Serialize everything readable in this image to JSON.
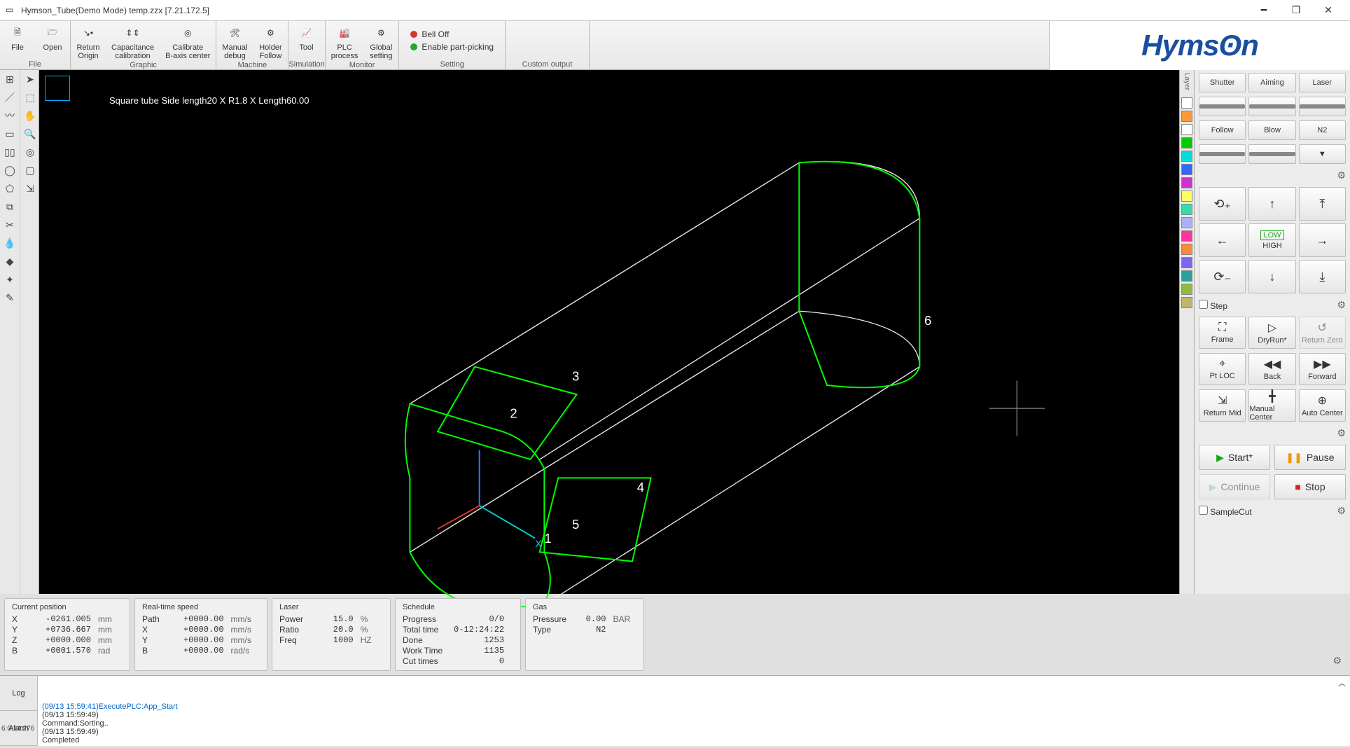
{
  "window": {
    "title": "Hymson_Tube(Demo Mode) temp.zzx  [7.21.172.5]"
  },
  "ribbon": {
    "groups": {
      "file": {
        "label": "File",
        "file": "File",
        "open": "Open"
      },
      "graphic": {
        "label": "Graphic",
        "return_origin": "Return\nOrigin",
        "cap_cal": "Capacitance\ncalibration",
        "cal_b": "Calibrate\nB-axis center"
      },
      "machine": {
        "label": "Machine",
        "manual_debug": "Manual\ndebug",
        "holder_follow": "Holder\nFollow"
      },
      "simulation": {
        "label": "Simulation",
        "tool": "Tool"
      },
      "monitor": {
        "label": "Monitor",
        "plc": "PLC\nprocess",
        "global": "Global\nsetting"
      },
      "setting": {
        "label": "Setting",
        "bell_off": "Bell Off",
        "part_picking": "Enable part-picking"
      },
      "custom": {
        "label": "Custom output"
      }
    },
    "logo": "Hymsʘn"
  },
  "canvas": {
    "info": "Square tube Side length20 X R1.8 X Length60.00",
    "markers": [
      "1",
      "2",
      "3",
      "4",
      "5",
      "6"
    ]
  },
  "layers": {
    "label": "Layer",
    "colors": [
      "#ffffff",
      "#ff9933",
      "#ffffff",
      "#00cc00",
      "#00dddd",
      "#3366ff",
      "#cc33cc",
      "#ffff66",
      "#33ddaa",
      "#aab0ff",
      "#ff3399",
      "#ff8833",
      "#7b68ee",
      "#2aa198",
      "#8fbc3f",
      "#bdb76b"
    ]
  },
  "right": {
    "toggles": [
      [
        "Shutter",
        "Aiming",
        "Laser"
      ],
      [
        "Follow",
        "Blow",
        "N2"
      ]
    ],
    "jog_center": {
      "low": "LOW",
      "high": "HIGH"
    },
    "step": "Step",
    "controls": [
      [
        "Frame",
        "DryRun*",
        "Return\nZero"
      ],
      [
        "Pt LOC",
        "Back",
        "Forward"
      ],
      [
        "Return\nMid",
        "Manual\nCenter",
        "Auto\nCenter"
      ]
    ],
    "start": "Start*",
    "pause": "Pause",
    "continue": "Continue",
    "stop": "Stop",
    "sample": "SampleCut"
  },
  "status": {
    "pos": {
      "title": "Current position",
      "rows": [
        {
          "k": "X",
          "v": "-0261.005",
          "u": "mm"
        },
        {
          "k": "Y",
          "v": "+0736.667",
          "u": "mm"
        },
        {
          "k": "Z",
          "v": "+0000.000",
          "u": "mm"
        },
        {
          "k": "B",
          "v": "+0001.570",
          "u": "rad"
        }
      ]
    },
    "speed": {
      "title": "Real-time speed",
      "rows": [
        {
          "k": "Path",
          "v": "+0000.00",
          "u": "mm/s"
        },
        {
          "k": "X",
          "v": "+0000.00",
          "u": "mm/s"
        },
        {
          "k": "Y",
          "v": "+0000.00",
          "u": "mm/s"
        },
        {
          "k": "B",
          "v": "+0000.00",
          "u": "rad/s"
        }
      ]
    },
    "laser": {
      "title": "Laser",
      "rows": [
        {
          "k": "Power",
          "v": "15.0",
          "u": "%"
        },
        {
          "k": "Ratio",
          "v": "20.0",
          "u": "%"
        },
        {
          "k": "Freq",
          "v": "1000",
          "u": "HZ"
        }
      ]
    },
    "schedule": {
      "title": "Schedule",
      "rows": [
        {
          "k": "Progress",
          "v": "0/0",
          "u": ""
        },
        {
          "k": "Total time",
          "v": "0-12:24:22",
          "u": ""
        },
        {
          "k": "Done",
          "v": "1253",
          "u": ""
        },
        {
          "k": "Work Time",
          "v": "1135",
          "u": ""
        },
        {
          "k": "Cut times",
          "v": "0",
          "u": ""
        }
      ]
    },
    "gas": {
      "title": "Gas",
      "rows": [
        {
          "k": "Pressure",
          "v": "0.00",
          "u": "BAR"
        },
        {
          "k": "Type",
          "v": "N2",
          "u": ""
        }
      ]
    }
  },
  "log": {
    "tab_log": "Log",
    "tab_alarm": "Alarm",
    "lines": [
      "(09/13 15:59:41)ExecutePLC:App_Start",
      "(09/13 15:59:49)",
      "Command:Sorting..",
      "(09/13 15:59:49)",
      "Completed"
    ]
  },
  "footer_time": "6:0:14:276"
}
